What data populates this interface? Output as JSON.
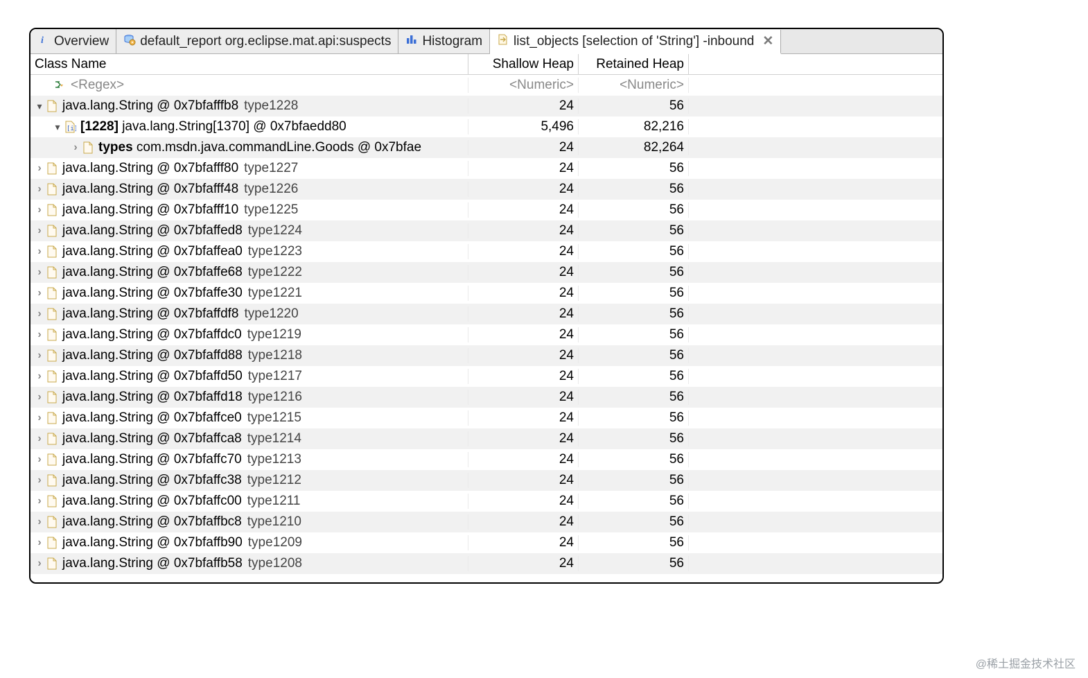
{
  "tabs": [
    {
      "label": "Overview",
      "icon": "info"
    },
    {
      "label": "default_report  org.eclipse.mat.api:suspects",
      "icon": "db-gear"
    },
    {
      "label": "Histogram",
      "icon": "bars"
    },
    {
      "label": "list_objects [selection of 'String'] -inbound",
      "icon": "file-arrow",
      "active": true,
      "closable": true
    }
  ],
  "columns": {
    "c1": "Class Name",
    "c2": "Shallow Heap",
    "c3": "Retained Heap"
  },
  "filter": {
    "regex_placeholder": "<Regex>",
    "numeric_placeholder": "<Numeric>"
  },
  "rows": [
    {
      "depth": 0,
      "twisty": "expanded",
      "icon": "file",
      "text": "java.lang.String @ 0x7bfafffb8",
      "suffix": "type1228",
      "shallow": "24",
      "retained": "56"
    },
    {
      "depth": 1,
      "twisty": "expanded",
      "icon": "array",
      "prefixBold": "[1228]",
      "text": " java.lang.String[1370] @ 0x7bfaedd80",
      "suffix": "",
      "shallow": "5,496",
      "retained": "82,216"
    },
    {
      "depth": 2,
      "twisty": "collapsed",
      "icon": "file",
      "prefixBold": "types",
      "text": " com.msdn.java.commandLine.Goods @ 0x7bfae",
      "suffix": "",
      "shallow": "24",
      "retained": "82,264"
    },
    {
      "depth": 0,
      "twisty": "collapsed",
      "icon": "file",
      "text": "java.lang.String @ 0x7bfafff80",
      "suffix": "type1227",
      "shallow": "24",
      "retained": "56"
    },
    {
      "depth": 0,
      "twisty": "collapsed",
      "icon": "file",
      "text": "java.lang.String @ 0x7bfafff48",
      "suffix": "type1226",
      "shallow": "24",
      "retained": "56"
    },
    {
      "depth": 0,
      "twisty": "collapsed",
      "icon": "file",
      "text": "java.lang.String @ 0x7bfafff10",
      "suffix": "type1225",
      "shallow": "24",
      "retained": "56"
    },
    {
      "depth": 0,
      "twisty": "collapsed",
      "icon": "file",
      "text": "java.lang.String @ 0x7bfaffed8",
      "suffix": "type1224",
      "shallow": "24",
      "retained": "56"
    },
    {
      "depth": 0,
      "twisty": "collapsed",
      "icon": "file",
      "text": "java.lang.String @ 0x7bfaffea0",
      "suffix": "type1223",
      "shallow": "24",
      "retained": "56"
    },
    {
      "depth": 0,
      "twisty": "collapsed",
      "icon": "file",
      "text": "java.lang.String @ 0x7bfaffe68",
      "suffix": "type1222",
      "shallow": "24",
      "retained": "56"
    },
    {
      "depth": 0,
      "twisty": "collapsed",
      "icon": "file",
      "text": "java.lang.String @ 0x7bfaffe30",
      "suffix": "type1221",
      "shallow": "24",
      "retained": "56"
    },
    {
      "depth": 0,
      "twisty": "collapsed",
      "icon": "file",
      "text": "java.lang.String @ 0x7bfaffdf8",
      "suffix": "type1220",
      "shallow": "24",
      "retained": "56"
    },
    {
      "depth": 0,
      "twisty": "collapsed",
      "icon": "file",
      "text": "java.lang.String @ 0x7bfaffdc0",
      "suffix": "type1219",
      "shallow": "24",
      "retained": "56"
    },
    {
      "depth": 0,
      "twisty": "collapsed",
      "icon": "file",
      "text": "java.lang.String @ 0x7bfaffd88",
      "suffix": "type1218",
      "shallow": "24",
      "retained": "56"
    },
    {
      "depth": 0,
      "twisty": "collapsed",
      "icon": "file",
      "text": "java.lang.String @ 0x7bfaffd50",
      "suffix": "type1217",
      "shallow": "24",
      "retained": "56"
    },
    {
      "depth": 0,
      "twisty": "collapsed",
      "icon": "file",
      "text": "java.lang.String @ 0x7bfaffd18",
      "suffix": "type1216",
      "shallow": "24",
      "retained": "56"
    },
    {
      "depth": 0,
      "twisty": "collapsed",
      "icon": "file",
      "text": "java.lang.String @ 0x7bfaffce0",
      "suffix": "type1215",
      "shallow": "24",
      "retained": "56"
    },
    {
      "depth": 0,
      "twisty": "collapsed",
      "icon": "file",
      "text": "java.lang.String @ 0x7bfaffca8",
      "suffix": "type1214",
      "shallow": "24",
      "retained": "56"
    },
    {
      "depth": 0,
      "twisty": "collapsed",
      "icon": "file",
      "text": "java.lang.String @ 0x7bfaffc70",
      "suffix": "type1213",
      "shallow": "24",
      "retained": "56"
    },
    {
      "depth": 0,
      "twisty": "collapsed",
      "icon": "file",
      "text": "java.lang.String @ 0x7bfaffc38",
      "suffix": "type1212",
      "shallow": "24",
      "retained": "56"
    },
    {
      "depth": 0,
      "twisty": "collapsed",
      "icon": "file",
      "text": "java.lang.String @ 0x7bfaffc00",
      "suffix": "type1211",
      "shallow": "24",
      "retained": "56"
    },
    {
      "depth": 0,
      "twisty": "collapsed",
      "icon": "file",
      "text": "java.lang.String @ 0x7bfaffbc8",
      "suffix": "type1210",
      "shallow": "24",
      "retained": "56"
    },
    {
      "depth": 0,
      "twisty": "collapsed",
      "icon": "file",
      "text": "java.lang.String @ 0x7bfaffb90",
      "suffix": "type1209",
      "shallow": "24",
      "retained": "56"
    },
    {
      "depth": 0,
      "twisty": "collapsed",
      "icon": "file",
      "text": "java.lang.String @ 0x7bfaffb58",
      "suffix": "type1208",
      "shallow": "24",
      "retained": "56"
    }
  ],
  "watermark": "@稀土掘金技术社区"
}
